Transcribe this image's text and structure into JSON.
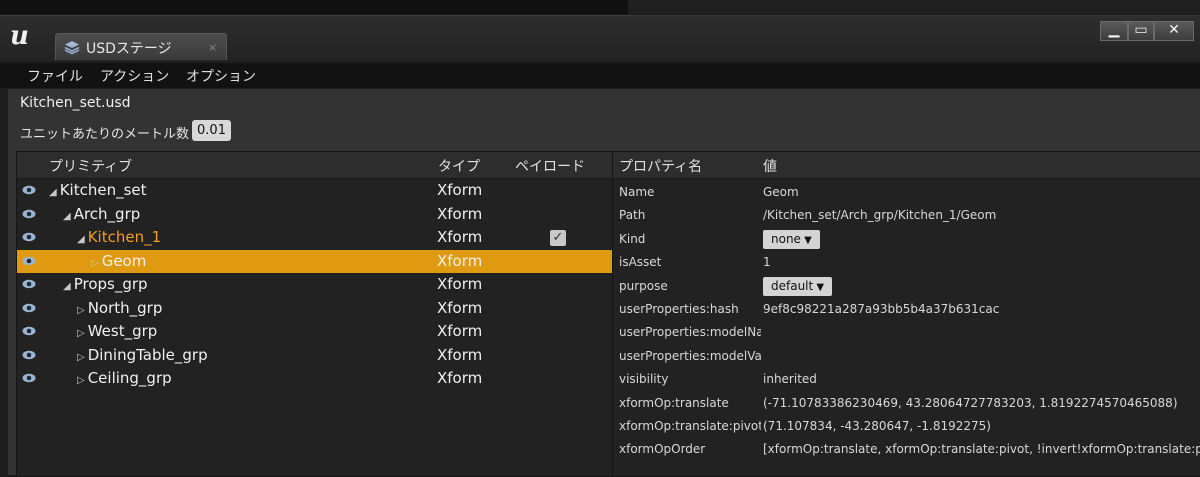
{
  "window": {
    "tab_label": "USDステージ",
    "tab_close": "×",
    "controls": {
      "minimize": "▁",
      "maximize": "▭",
      "close": "✕"
    }
  },
  "menu": {
    "items": [
      "ファイル",
      "アクション",
      "オプション"
    ]
  },
  "stage": {
    "filename": "Kitchen_set.usd",
    "meters_per_unit_label": "ユニットあたりのメートル数",
    "meters_per_unit_value": "0.01"
  },
  "tree": {
    "headers": {
      "primitive": "プリミティブ",
      "type": "タイプ",
      "payload": "ペイロード"
    },
    "rows": [
      {
        "name": "Kitchen_set",
        "type": "Xform",
        "arrow": "◢",
        "indent": 0,
        "payload": false,
        "selected": false,
        "highlight": false
      },
      {
        "name": "Arch_grp",
        "type": "Xform",
        "arrow": "◢",
        "indent": 1,
        "payload": false,
        "selected": false,
        "highlight": false
      },
      {
        "name": "Kitchen_1",
        "type": "Xform",
        "arrow": "◢",
        "indent": 2,
        "payload": true,
        "selected": false,
        "highlight": true
      },
      {
        "name": "Geom",
        "type": "Xform",
        "arrow": "▷",
        "indent": 3,
        "payload": false,
        "selected": true,
        "highlight": false
      },
      {
        "name": "Props_grp",
        "type": "Xform",
        "arrow": "◢",
        "indent": 1,
        "payload": false,
        "selected": false,
        "highlight": false
      },
      {
        "name": "North_grp",
        "type": "Xform",
        "arrow": "▷",
        "indent": 2,
        "payload": false,
        "selected": false,
        "highlight": false
      },
      {
        "name": "West_grp",
        "type": "Xform",
        "arrow": "▷",
        "indent": 2,
        "payload": false,
        "selected": false,
        "highlight": false
      },
      {
        "name": "DiningTable_grp",
        "type": "Xform",
        "arrow": "▷",
        "indent": 2,
        "payload": false,
        "selected": false,
        "highlight": false
      },
      {
        "name": "Ceiling_grp",
        "type": "Xform",
        "arrow": "▷",
        "indent": 2,
        "payload": false,
        "selected": false,
        "highlight": false
      }
    ],
    "colors": {
      "selected_bg": "#e09a12",
      "highlight_text": "#f0a020"
    }
  },
  "properties": {
    "headers": {
      "name": "プロパティ名",
      "value": "値"
    },
    "rows": [
      {
        "name": "Name",
        "value": "Geom",
        "combo": false
      },
      {
        "name": "Path",
        "value": "/Kitchen_set/Arch_grp/Kitchen_1/Geom",
        "combo": false
      },
      {
        "name": "Kind",
        "value": "none",
        "combo": true
      },
      {
        "name": "isAsset",
        "value": "1",
        "combo": false
      },
      {
        "name": "purpose",
        "value": "default",
        "combo": true
      },
      {
        "name": "userProperties:hash",
        "value": "9ef8c98221a287a93bb5b4a37b631cac",
        "combo": false
      },
      {
        "name": "userProperties:modelName",
        "value": "",
        "combo": false
      },
      {
        "name": "userProperties:modelVariant",
        "value": "",
        "combo": false
      },
      {
        "name": "visibility",
        "value": "inherited",
        "combo": false
      },
      {
        "name": "xformOp:translate",
        "value": "(-71.10783386230469, 43.28064727783203, 1.8192274570465088)",
        "combo": false
      },
      {
        "name": "xformOp:translate:pivot",
        "value": "(71.107834, -43.280647, -1.8192275)",
        "combo": false
      },
      {
        "name": "xformOpOrder",
        "value": "[xformOp:translate, xformOp:translate:pivot, !invert!xformOp:translate:pivot]",
        "combo": false
      }
    ]
  }
}
